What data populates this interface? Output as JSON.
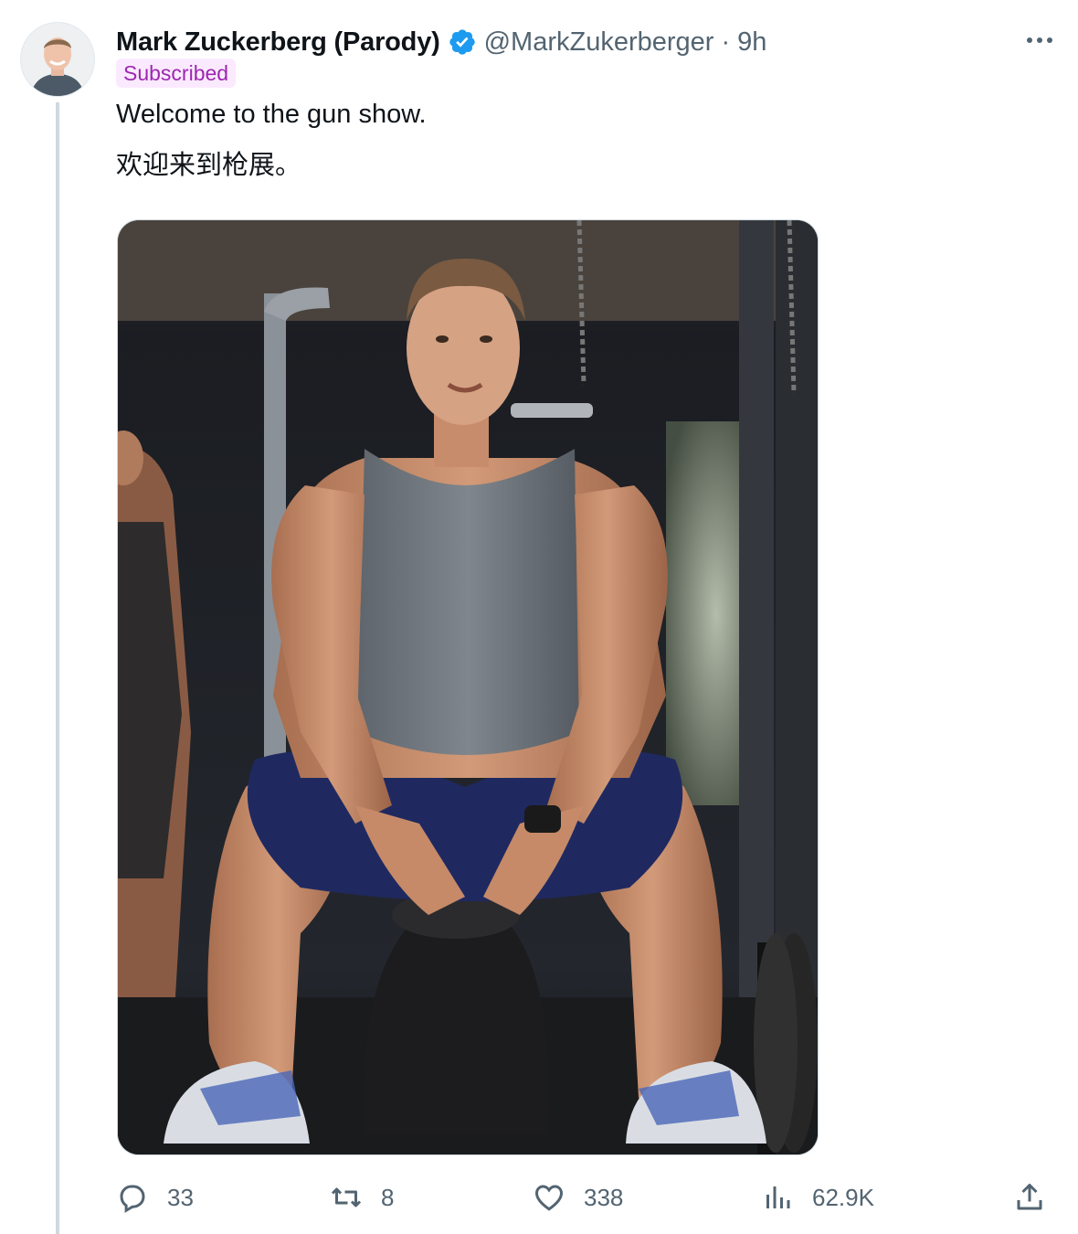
{
  "tweet": {
    "author_name": "Mark Zuckerberg (Parody)",
    "handle": "@MarkZukerberger",
    "separator": "·",
    "time": "9h",
    "subscribed_label": "Subscribed",
    "text_en": "Welcome to the gun show.",
    "text_zh": "欢迎来到枪展。",
    "verified_color": "#1d9bf0"
  },
  "actions": {
    "replies": "33",
    "retweets": "8",
    "likes": "338",
    "views": "62.9K"
  },
  "icons": {
    "verified": "verified-badge-icon",
    "more": "more-icon",
    "reply": "reply-icon",
    "retweet": "retweet-icon",
    "like": "heart-icon",
    "views": "views-chart-icon",
    "share": "share-icon"
  }
}
